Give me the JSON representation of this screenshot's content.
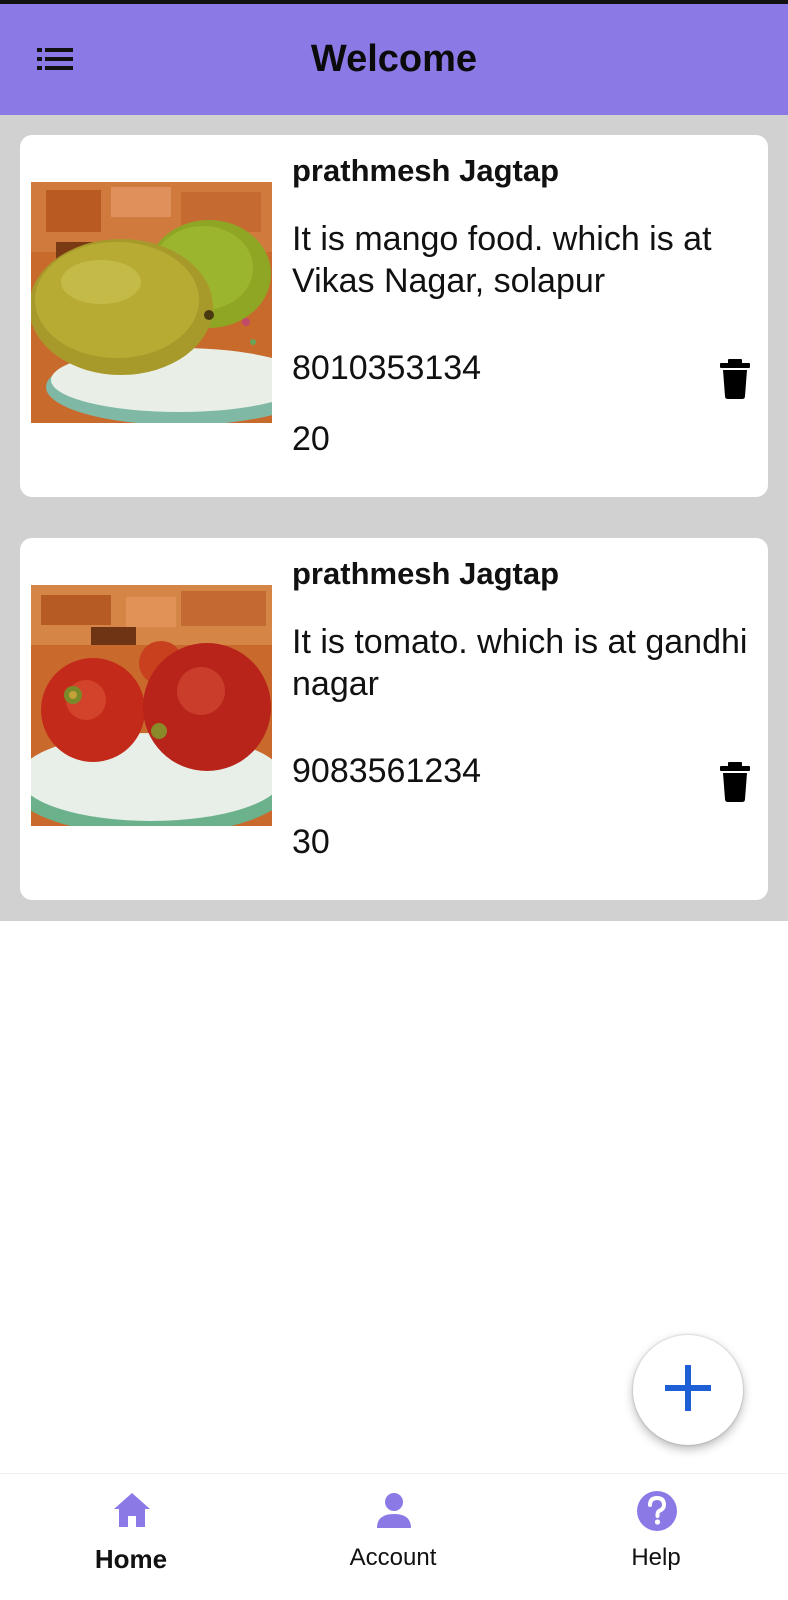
{
  "header": {
    "title": "Welcome",
    "menu_icon": "list-menu-icon",
    "background": "#8b7ae6"
  },
  "posts": [
    {
      "owner": "prathmesh Jagtap",
      "description": "It is mango food. which is at Vikas Nagar, solapur",
      "phone": "8010353134",
      "quantity": "20",
      "image": "mango-photo",
      "delete_icon": "trash-icon"
    },
    {
      "owner": "prathmesh Jagtap",
      "description": "It is tomato. which is at gandhi nagar",
      "phone": "9083561234",
      "quantity": "30",
      "image": "tomato-photo",
      "delete_icon": "trash-icon"
    }
  ],
  "fab": {
    "icon": "plus-icon",
    "color": "#1f5fd6"
  },
  "bottom_nav": {
    "items": [
      {
        "label": "Home",
        "icon": "home-icon",
        "active": true
      },
      {
        "label": "Account",
        "icon": "person-icon",
        "active": false
      },
      {
        "label": "Help",
        "icon": "help-circle-icon",
        "active": false
      }
    ],
    "icon_color": "#8b7ae6"
  }
}
